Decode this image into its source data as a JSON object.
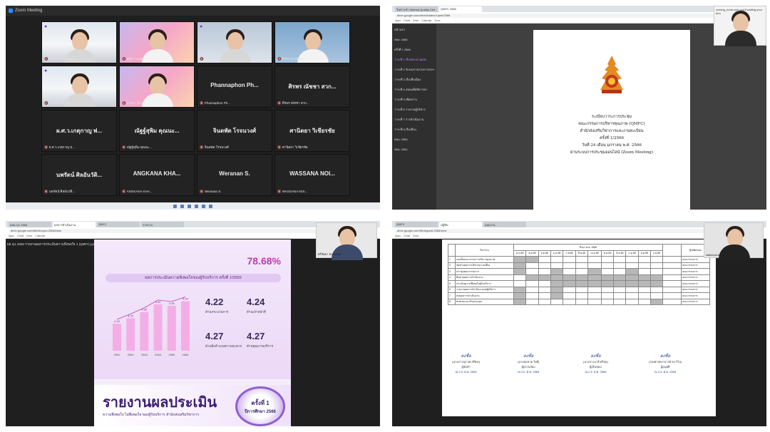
{
  "q1": {
    "app_title": "Zoom Meeting",
    "participants": [
      {
        "name": "",
        "caption": "สรพศ สำนักส่งเสริม",
        "style": "cam"
      },
      {
        "name": "",
        "caption": "สุธิดา บุญส่ง",
        "style": "cam2"
      },
      {
        "name": "",
        "caption": "Phannaphon",
        "style": "cam3"
      },
      {
        "name": "",
        "caption": "ศิรพร ณ อยุธยา",
        "style": "cam4"
      },
      {
        "name": "",
        "caption": "กาญจนา ลำพูน",
        "style": "cam"
      },
      {
        "name": "",
        "caption": "อรอุมา อินทร์",
        "style": "cam2"
      },
      {
        "name": "Phannaphon Ph...",
        "caption": "Phannaphon Ph...",
        "style": "plain"
      },
      {
        "name": "ศิรพร ณัชชา สวก...",
        "caption": "ศิรพร ณัชชา สวก...",
        "style": "plain"
      },
      {
        "name": "ผ.ศ.ว.เกตุกาญ พ่...",
        "caption": "ผ.ศ.ว.เกตุกาญ พ่...",
        "style": "plain"
      },
      {
        "name": "ณัฐฐ์สุพิม คุณนะ...",
        "caption": "ณัฐฐ์สุพิม คุณนะ...",
        "style": "plain"
      },
      {
        "name": "จินตพัด โรจนวงศ์",
        "caption": "จินตพัด โรจนวงศ์",
        "style": "plain"
      },
      {
        "name": "ศานิตยา วิเชียรชัย",
        "caption": "ศานิตยา วิเชียรชัย",
        "style": "plain"
      },
      {
        "name": "นพรัตน์ ศิลอันวัติ...",
        "caption": "นพรัตน์ ศิลอันวัติ...",
        "style": "plain"
      },
      {
        "name": "ANGKANA KHA...",
        "caption": "ANGKANA KHA...",
        "style": "plain"
      },
      {
        "name": "Weranan S.",
        "caption": "Weranan S.",
        "style": "plain"
      },
      {
        "name": "WASSANA NOI...",
        "caption": "WASSANA NOI...",
        "style": "plain"
      }
    ]
  },
  "q2": {
    "tabs": [
      "วิเคราะห์ / Internal Quality Cert",
      "QMFC 2566"
    ],
    "url": "drive.google.com/drive/folders/1qmfc2566",
    "sidebar": [
      "หน้าแรก",
      "คณะ 2566",
      "ครั้งที่ 1 2566",
      "วาระที่ 1 เรื่องประธานแจ้ง",
      "วาระที่ 2 รับรองรายงานการประชุม",
      "วาระที่ 3 เรื่องสืบเนื่อง",
      "วาระที่ 4 เสนอเพื่อพิจารณา",
      "วาระที่ 5 เพื่อทราบ",
      "วาระที่ 6 รายงานผู้บริหาร",
      "วาระที่ 7 การดำเนินงาน",
      "วาระที่ 8 เรื่องอื่นๆ",
      "คณะ 2565",
      "คณะ 2564"
    ],
    "doc_lines": [
      "ระเบียบวาระการประชุม",
      "คณะกรรมการบริหารคุณภาพ (QMFC)",
      "สำนักส่งเสริมวิชาการและงานทะเบียน",
      "ครั้งที่ 1/2566",
      "วันที่ 24 เดือน มกราคม พ.ศ. 2566",
      "ผ่านระบบการประชุมออนไลน์ (Zoom Meeting)"
    ],
    "corner_label": "coming_most.com.you'll waiting your turn"
  },
  "q3": {
    "tabs": [
      "แผน Q1 2566",
      "ผลการดำเนินงาน",
      "QMFC",
      "รายงาน"
    ],
    "url": "drive.google.com/file/d/report-2566/view",
    "title_bar": "ผล Q1 2565 รายงานผลการประเมินความพึงพอใจ 1 (QMFC).pdf",
    "percent": "78.68%",
    "section_title": "ผลการประเมินความพึงพอใจของผู้รับบริการ ครั้งที่ 1/2565",
    "chart_data": {
      "type": "bar",
      "categories": [
        "2561",
        "2562",
        "2563",
        "2564",
        "2565",
        "2566"
      ],
      "values": [
        4.15,
        4.22,
        4.3,
        4.4,
        4.38,
        4.44
      ],
      "title": "",
      "ylim": [
        3.8,
        4.5
      ]
    },
    "scores": [
      {
        "value": "4.22",
        "label": "ด้านกระบวนการ"
      },
      {
        "value": "4.24",
        "label": "ด้านเจ้าหน้าที่"
      },
      {
        "value": "4.27",
        "label": "ด้านสิ่งอำนวยความสะดวก"
      },
      {
        "value": "4.27",
        "label": "ด้านคุณภาพบริการ"
      }
    ],
    "report_title": "รายงานผลประเมิน",
    "report_sub": "ความพึงพอใจ ไม่พึงพอใจ ของผู้รับบริการ สำนักส่งเสริมวิชาการ",
    "round_label": "ครั้งที่ 1",
    "round_year": "ปีการศึกษา 2566",
    "cam_name": "ศรีชัยยา ชนาเกษม"
  },
  "q4": {
    "tabs": [
      "QMFC",
      "ปฏิทิน",
      "แผนงาน"
    ],
    "url": "drive.google.com/file/d/gantt-2566/view",
    "header_year": "ปีงบฯ พ.ศ. 2566",
    "months": [
      "ต.ค.65",
      "พ.ย.65",
      "ธ.ค.65",
      "ม.ค.66",
      "ก.พ.66",
      "มี.ค.66",
      "เม.ย.66",
      "พ.ค.66",
      "มิ.ย.66",
      "ก.ค.66",
      "ส.ค.66",
      "ก.ย.66"
    ],
    "col_activity": "กิจกรรม",
    "col_owner": "ผู้รับผิดชอบ",
    "rows": [
      {
        "no": "1",
        "text": "แต่งตั้งคณะกรรมการบริหารคุณภาพ",
        "owner": "คณะกรรมการ"
      },
      {
        "no": "2",
        "text": "จัดทำแผนการบริหารความเสี่ยง",
        "owner": "คณะกรรมการ"
      },
      {
        "no": "3",
        "text": "ประชุมคณะกรรมการ",
        "owner": "คณะกรรมการ"
      },
      {
        "no": "4",
        "text": "ติดตามผลการดำเนินงาน",
        "owner": "คณะกรรมการ"
      },
      {
        "no": "5",
        "text": "ประเมินความพึงพอใจผู้รับบริการ",
        "owner": "คณะกรรมการ"
      },
      {
        "no": "6",
        "text": "รายงานผลการดำเนินงานต่อผู้บริหาร",
        "owner": "คณะกรรมการ"
      },
      {
        "no": "7",
        "text": "สรุปผลการดำเนินงาน",
        "owner": "คณะกรรมการ"
      },
      {
        "no": "8",
        "text": "ทบทวนและปรับปรุงแผน",
        "owner": "คณะกรรมการ"
      }
    ],
    "signatures": [
      {
        "hand": "ลงชื่อ",
        "line1": "(นางสาวสุภาพร ศิริพร)",
        "line2": "ผู้จัดทำ",
        "date": "ณ 2.5 .ต.ค. 2565"
      },
      {
        "hand": "ลงชื่อ",
        "line1": "(นายสมชาย ใจดี)",
        "line2": "ผู้ตรวจสอบ",
        "date": "ณ 2.5 .ต.ค. 2565"
      },
      {
        "hand": "ลงชื่อ",
        "line1": "(นางสาวมาลี ศรีสุข)",
        "line2": "ผู้เห็นชอบ",
        "date": "ณ 2.5 .ต.ค. 2565"
      },
      {
        "hand": "ลงชื่อ",
        "line1": "(รองศาสตราจารย์ ดร.วิไล)",
        "line2": "ผู้อนุมัติ",
        "date": "ณ 2.5 .ต.ค. 2565"
      }
    ],
    "cam_name": "sitthichai.book"
  }
}
